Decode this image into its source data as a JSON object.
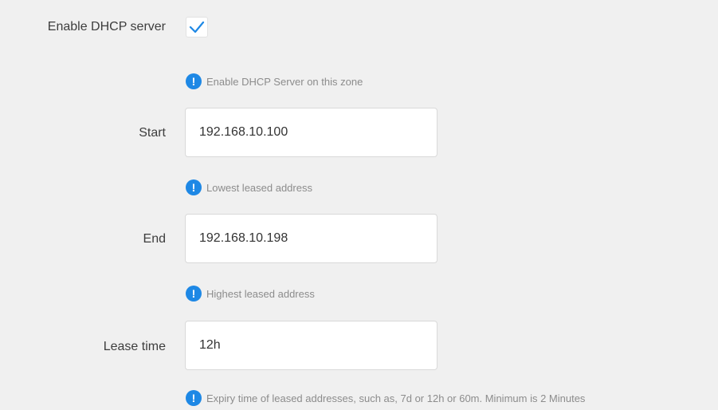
{
  "dhcp": {
    "enable_label": "Enable DHCP server",
    "enable_checked": true,
    "enable_hint": "Enable DHCP Server on this zone",
    "start_label": "Start",
    "start_value": "192.168.10.100",
    "start_hint": "Lowest leased address",
    "end_label": "End",
    "end_value": "192.168.10.198",
    "end_hint": "Highest leased address",
    "lease_label": "Lease time",
    "lease_value": "12h",
    "lease_hint": "Expiry time of leased addresses, such as, 7d or 12h or 60m. Minimum is 2 Minutes"
  },
  "icons": {
    "checkmark": "checkmark-icon",
    "info": "info-icon"
  },
  "colors": {
    "accent": "#1e88e5",
    "background": "#f0f0f0",
    "hint_text": "#8c8c8c"
  }
}
